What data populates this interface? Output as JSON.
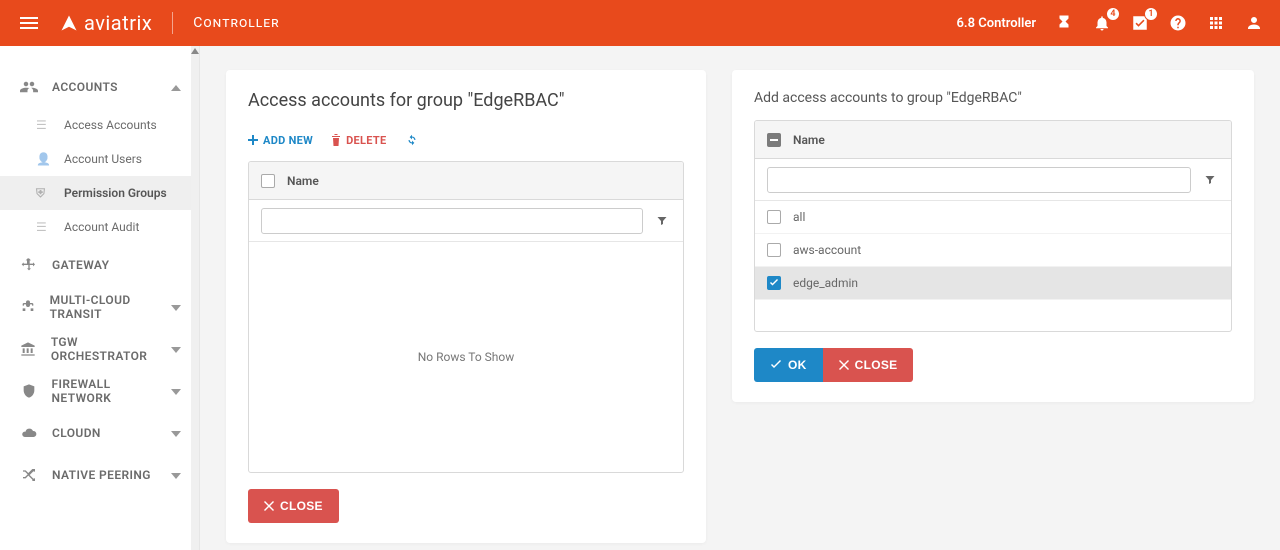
{
  "header": {
    "brand": "aviatrix",
    "subtitle": "Controller",
    "version": "6.8 Controller",
    "badges": {
      "bell": "4",
      "check": "1"
    }
  },
  "sidebar": {
    "top": {
      "label": "ACCOUNTS",
      "subs": [
        {
          "label": "Access Accounts"
        },
        {
          "label": "Account Users"
        },
        {
          "label": "Permission Groups",
          "active": true
        },
        {
          "label": "Account Audit"
        }
      ]
    },
    "items": [
      {
        "label": "GATEWAY"
      },
      {
        "label": "MULTI-CLOUD TRANSIT"
      },
      {
        "label": "TGW ORCHESTRATOR"
      },
      {
        "label": "FIREWALL NETWORK"
      },
      {
        "label": "CLOUDN"
      },
      {
        "label": "NATIVE PEERING"
      }
    ]
  },
  "left_panel": {
    "title": "Access accounts for group \"EdgeRBAC\"",
    "toolbar": {
      "add": "ADD NEW",
      "delete": "DELETE"
    },
    "grid": {
      "header": "Name",
      "empty": "No Rows To Show"
    },
    "close": "CLOSE"
  },
  "right_panel": {
    "title": "Add access accounts to group \"EdgeRBAC\"",
    "grid": {
      "header": "Name",
      "rows": [
        {
          "label": "all",
          "checked": false
        },
        {
          "label": "aws-account",
          "checked": false
        },
        {
          "label": "edge_admin",
          "checked": true
        }
      ]
    },
    "ok": "OK",
    "close": "CLOSE"
  }
}
